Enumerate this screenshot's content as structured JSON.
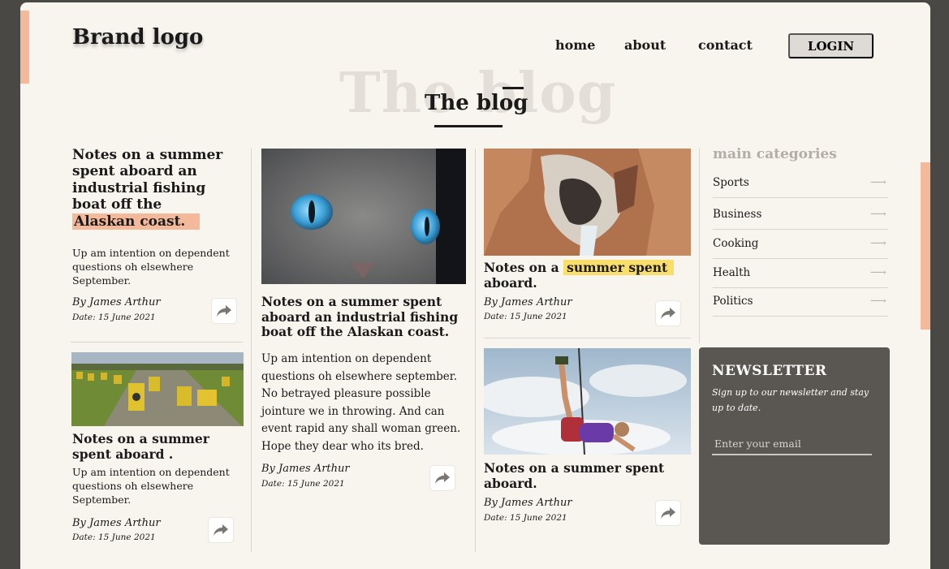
{
  "brand": "Brand logo",
  "nav": {
    "home": "home",
    "about": "about",
    "contact": "contact",
    "login": "LOGIN"
  },
  "hero": {
    "background_word": "The blog",
    "title": "The blog"
  },
  "posts": {
    "p1": {
      "title_main": "Notes on a summer spent aboard an industrial fishing boat off the",
      "title_highlight": "Alaskan coast.",
      "excerpt": "Up am intention on dependent questions oh elsewhere September.",
      "author": "By James Arthur",
      "date": "Date: 15 June 2021"
    },
    "p2": {
      "title": "Notes on a summer spent aboard .",
      "excerpt": "Up am intention on dependent questions oh elsewhere September.",
      "author": "By James Arthur",
      "date": "Date: 15 June 2021"
    },
    "p3": {
      "title": "Notes on a summer spent aboard an industrial fishing boat off the Alaskan coast.",
      "excerpt": "Up am intention on dependent questions oh elsewhere september. No betrayed pleasure possible jointure we in throwing. And can event rapid any shall woman green. Hope they dear who its bred.",
      "author": "By James Arthur",
      "date": "Date: 15 June 2021"
    },
    "p4": {
      "title_prefix": "Notes on a",
      "title_highlight": "summer spent",
      "title_suffix": "aboard.",
      "author": "By James Arthur",
      "date": "Date: 15 June 2021"
    },
    "p5": {
      "title": "Notes on a summer spent aboard.",
      "author": "By James Arthur",
      "date": "Date: 15 June 2021"
    }
  },
  "categories": {
    "heading": "main categories",
    "items": [
      {
        "label": "Sports"
      },
      {
        "label": "Business"
      },
      {
        "label": "Cooking"
      },
      {
        "label": "Health"
      },
      {
        "label": "Politics"
      }
    ],
    "arrow": "⟶"
  },
  "newsletter": {
    "title": "NEWSLETTER",
    "subtitle": "Sign up to our newsletter and stay up to date.",
    "placeholder": "Enter your email"
  },
  "colors": {
    "page_bg": "#f8f4ee",
    "accent_peach": "#f4b89a",
    "highlight_yellow": "#f9de6b",
    "newsletter_bg": "#5a5752"
  },
  "icons": {
    "share": "share-arrow-icon",
    "category_arrow": "long-arrow-right-icon"
  }
}
